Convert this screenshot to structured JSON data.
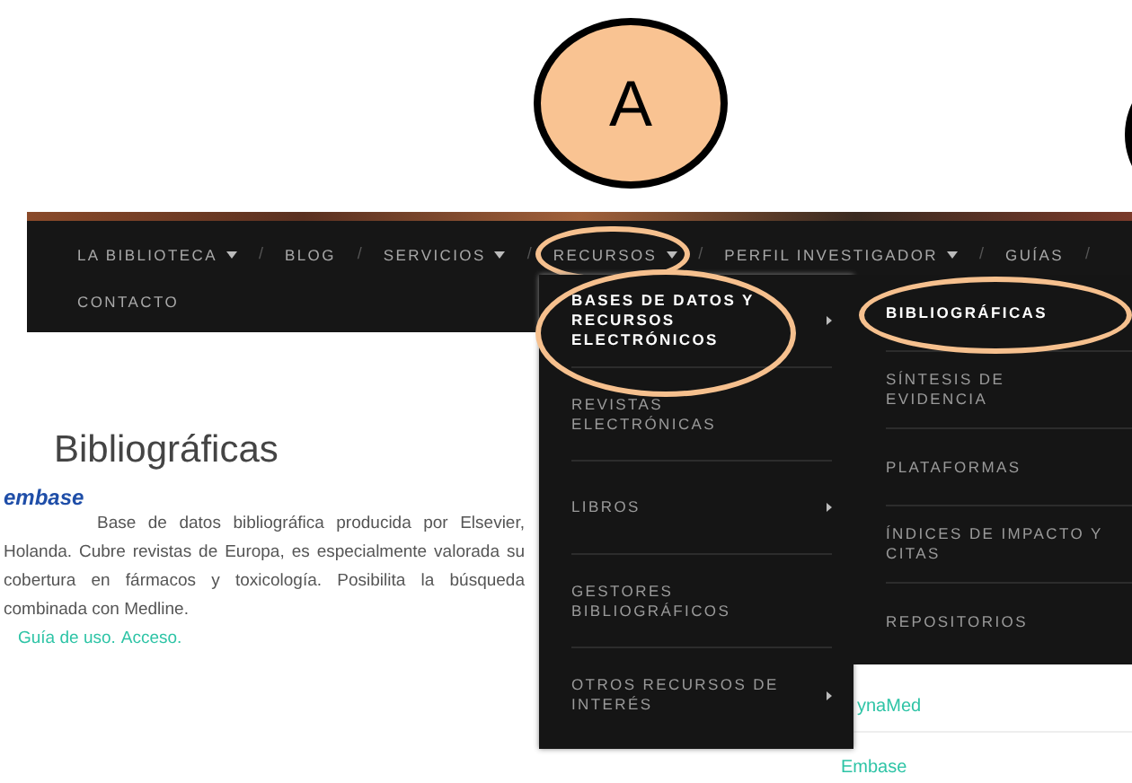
{
  "annotation_label": "A",
  "nav": {
    "separator": "/",
    "rows": [
      [
        {
          "label": "LA BIBLIOTECA",
          "dropdown": true,
          "circled": false
        },
        {
          "label": "BLOG",
          "dropdown": false,
          "circled": false
        },
        {
          "label": "SERVICIOS",
          "dropdown": true,
          "circled": false
        },
        {
          "label": "RECURSOS",
          "dropdown": true,
          "circled": true
        },
        {
          "label": "PERFIL INVESTIGADOR",
          "dropdown": true,
          "circled": false
        },
        {
          "label": "GUÍAS",
          "dropdown": false,
          "circled": false
        }
      ],
      [
        {
          "label": "CONTACTO",
          "dropdown": false,
          "circled": false
        }
      ]
    ]
  },
  "menu": [
    {
      "label": "BASES DE DATOS Y RECURSOS ELECTRÓNICOS",
      "submenu": true,
      "selected": true,
      "circled": true
    },
    {
      "label": "REVISTAS ELECTRÓNICAS",
      "submenu": false,
      "selected": false,
      "circled": false
    },
    {
      "label": "LIBROS",
      "submenu": true,
      "selected": false,
      "circled": false
    },
    {
      "label": "GESTORES BIBLIOGRÁFICOS",
      "submenu": false,
      "selected": false,
      "circled": false
    },
    {
      "label": "OTROS RECURSOS DE INTERÉS",
      "submenu": true,
      "selected": false,
      "circled": false
    }
  ],
  "submenu": [
    {
      "label": "BIBLIOGRÁFICAS",
      "selected": true,
      "circled": true
    },
    {
      "label": "SÍNTESIS DE EVIDENCIA",
      "selected": false,
      "circled": false
    },
    {
      "label": "PLATAFORMAS",
      "selected": false,
      "circled": false
    },
    {
      "label": "ÍNDICES DE IMPACTO Y CITAS",
      "selected": false,
      "circled": false
    },
    {
      "label": "REPOSITORIOS",
      "selected": false,
      "circled": false
    }
  ],
  "content": {
    "title": "Bibliográficas",
    "logo": "embase",
    "description": "Base de datos bibliográfica producida por Elsevier, Holanda. Cubre revistas de Europa, es especialmente valorada su cobertura en fármacos y toxicología. Posibilita la búsqueda combinada con Medline.",
    "links": [
      "Guía de uso.",
      "Acceso."
    ]
  },
  "side_links": [
    "ynaMed",
    "Embase"
  ]
}
